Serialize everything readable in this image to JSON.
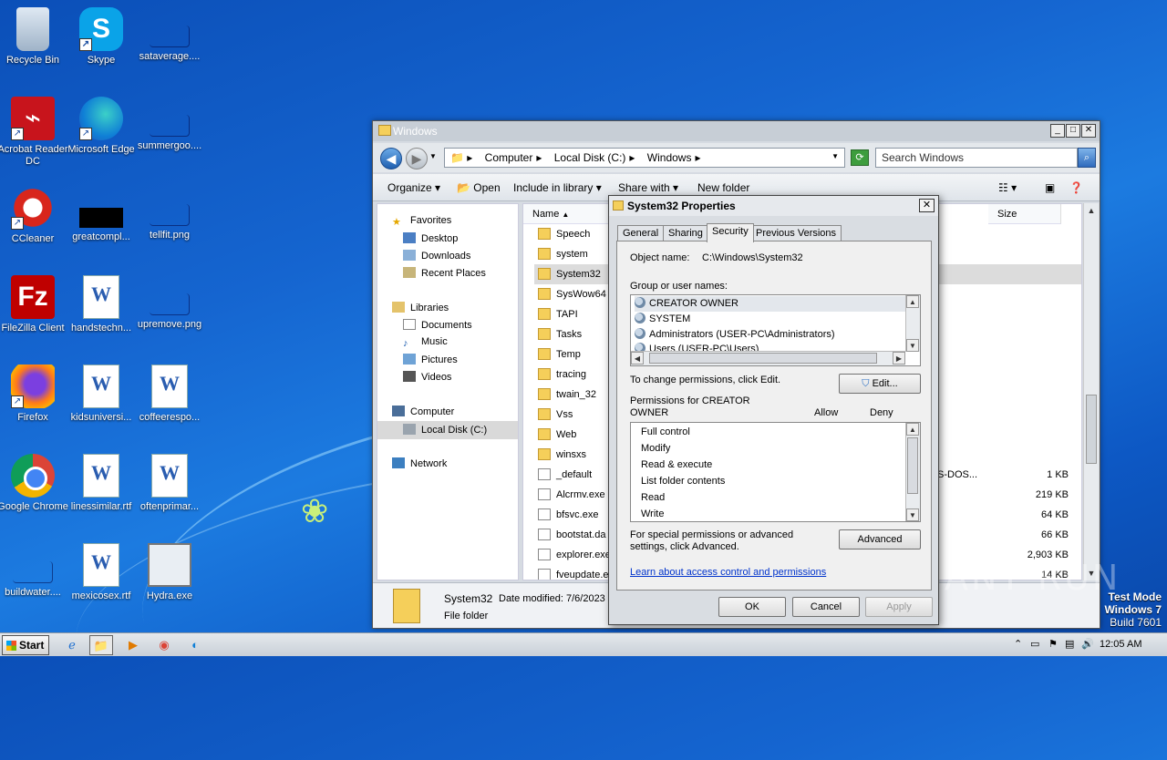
{
  "desktop": {
    "icons": [
      {
        "label": "Recycle Bin"
      },
      {
        "label": "Skype"
      },
      {
        "label": "sataverage...."
      },
      {
        "label": "Acrobat Reader DC"
      },
      {
        "label": "Microsoft Edge"
      },
      {
        "label": "summergoo...."
      },
      {
        "label": "CCleaner"
      },
      {
        "label": "greatcompl..."
      },
      {
        "label": "tellfit.png"
      },
      {
        "label": "FileZilla Client"
      },
      {
        "label": "handstechn..."
      },
      {
        "label": "upremove.png"
      },
      {
        "label": "Firefox"
      },
      {
        "label": "kidsuniversi..."
      },
      {
        "label": "coffeerespo..."
      },
      {
        "label": "Google Chrome"
      },
      {
        "label": "linessimilar.rtf"
      },
      {
        "label": "oftenprimar..."
      },
      {
        "label": "buildwater...."
      },
      {
        "label": "mexicosex.rtf"
      },
      {
        "label": "Hydra.exe"
      }
    ]
  },
  "explorer": {
    "title": "Windows",
    "address": [
      "Computer",
      "Local Disk (C:)",
      "Windows"
    ],
    "search_placeholder": "Search Windows",
    "commands": {
      "organize": "Organize",
      "open": "Open",
      "include": "Include in library",
      "share": "Share with",
      "new_folder": "New folder"
    },
    "nav": {
      "favorites": "Favorites",
      "desktop": "Desktop",
      "downloads": "Downloads",
      "recent": "Recent Places",
      "libraries": "Libraries",
      "documents": "Documents",
      "music": "Music",
      "pictures": "Pictures",
      "videos": "Videos",
      "computer": "Computer",
      "local_disk": "Local Disk (C:)",
      "network": "Network"
    },
    "columns": {
      "name": "Name",
      "size": "Size"
    },
    "files": [
      {
        "name": "Speech",
        "type": "",
        "size": ""
      },
      {
        "name": "system",
        "type": "",
        "size": ""
      },
      {
        "name": "System32",
        "type": "",
        "size": ""
      },
      {
        "name": "SysWow64",
        "type": "",
        "size": ""
      },
      {
        "name": "TAPI",
        "type": "",
        "size": ""
      },
      {
        "name": "Tasks",
        "type": "",
        "size": ""
      },
      {
        "name": "Temp",
        "type": "",
        "size": ""
      },
      {
        "name": "tracing",
        "type": "",
        "size": ""
      },
      {
        "name": "twain_32",
        "type": "",
        "size": ""
      },
      {
        "name": "Vss",
        "type": "",
        "size": ""
      },
      {
        "name": "Web",
        "type": "",
        "size": ""
      },
      {
        "name": "winsxs",
        "type": "",
        "size": ""
      },
      {
        "name": "_default",
        "type": "S-DOS...",
        "size": "1 KB"
      },
      {
        "name": "Alcrmv.exe",
        "type": "",
        "size": "219 KB"
      },
      {
        "name": "bfsvc.exe",
        "type": "",
        "size": "64 KB"
      },
      {
        "name": "bootstat.da",
        "type": "",
        "size": "66 KB"
      },
      {
        "name": "explorer.exe",
        "type": "",
        "size": "2,903 KB"
      },
      {
        "name": "fveupdate.e",
        "type": "",
        "size": "14 KB"
      }
    ],
    "details": {
      "name": "System32",
      "modified": "Date modified: 7/6/2023",
      "kind": "File folder"
    }
  },
  "dialog": {
    "title": "System32 Properties",
    "tabs": [
      "General",
      "Sharing",
      "Security",
      "Previous Versions"
    ],
    "object_label": "Object name:",
    "object_value": "C:\\Windows\\System32",
    "group_label": "Group or user names:",
    "users": [
      "CREATOR OWNER",
      "SYSTEM",
      "Administrators (USER-PC\\Administrators)",
      "Users (USER-PC\\Users)"
    ],
    "change_text": "To change permissions, click Edit.",
    "edit_btn": "Edit...",
    "perm_label": "Permissions for CREATOR OWNER",
    "allow": "Allow",
    "deny": "Deny",
    "permissions": [
      "Full control",
      "Modify",
      "Read & execute",
      "List folder contents",
      "Read",
      "Write"
    ],
    "special_text": "For special permissions or advanced settings, click Advanced.",
    "advanced_btn": "Advanced",
    "link": "Learn about access control and permissions",
    "ok": "OK",
    "cancel": "Cancel",
    "apply": "Apply"
  },
  "taskbar": {
    "start": "Start",
    "clock": "12:05 AM"
  },
  "watermark": "ANY RUN",
  "testmode": {
    "line1": "Test Mode",
    "line2": "Windows 7",
    "line3": "Build 7601"
  }
}
